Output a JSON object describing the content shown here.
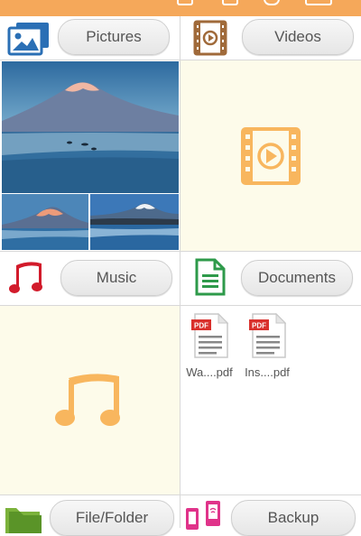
{
  "header_bar": {
    "icons": [
      "crop-icon",
      "square-icon",
      "gear-icon",
      "battery-icon"
    ]
  },
  "sections": {
    "pictures": {
      "label": "Pictures",
      "icon": "pictures-icon"
    },
    "videos": {
      "label": "Videos",
      "icon": "video-film-icon"
    },
    "music": {
      "label": "Music",
      "icon": "music-note-icon"
    },
    "documents": {
      "label": "Documents",
      "icon": "document-icon"
    },
    "file_folder": {
      "label": "File/Folder",
      "icon": "folder-icon"
    },
    "backup": {
      "label": "Backup",
      "icon": "backup-phone-icon"
    }
  },
  "documents_files": [
    {
      "name": "Wa....pdf",
      "badge": "PDF"
    },
    {
      "name": "Ins....pdf",
      "badge": "PDF"
    }
  ],
  "colors": {
    "accent": "#f5a85a",
    "placeholder_bg": "#fdfbea",
    "placeholder_icon": "#f8b65e",
    "music_red": "#d21b2b",
    "doc_green": "#2e9a4a",
    "video_brown": "#a06a3a",
    "pictures_blue": "#2a6fb5"
  }
}
